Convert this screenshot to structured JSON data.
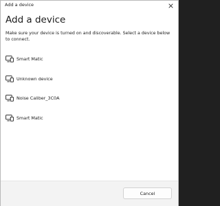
{
  "window": {
    "title": "Add a device",
    "close_icon": "close-icon"
  },
  "main": {
    "heading": "Add a device",
    "description": "Make sure your device is turned on and discoverable. Select a device below to connect."
  },
  "devices": [
    {
      "label": "Smart Matic",
      "icon": "display-device-icon"
    },
    {
      "label": "Unknown device",
      "icon": "display-device-icon"
    },
    {
      "label": "Noise Caliber_3C0A",
      "icon": "display-device-icon"
    },
    {
      "label": "Smart Matic",
      "icon": "display-device-icon"
    }
  ],
  "footer": {
    "cancel_label": "Cancel"
  },
  "colors": {
    "background": "#ffffff",
    "footer_background": "#f3f3f3",
    "text": "#1b1b1b",
    "button_border": "#d1d1d1"
  }
}
